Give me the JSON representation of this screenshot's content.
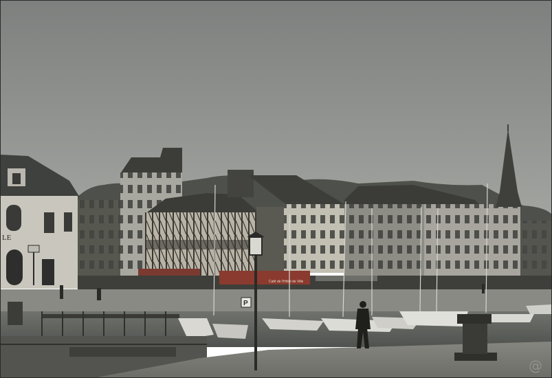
{
  "photo": {
    "sky_color": "#8d8f8e",
    "water_color": "#5f625e",
    "quay_color": "#7c7d78",
    "awning_color": "#8a3a2e"
  },
  "signage": {
    "left_building_fragment": "LE",
    "restaurant_awning": "Café de l'Hôtel de Ville",
    "parking_sign": "P"
  },
  "watermark": {
    "text": "@"
  }
}
